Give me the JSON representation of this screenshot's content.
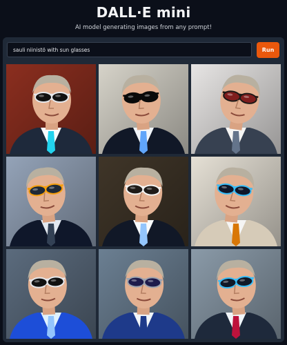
{
  "header": {
    "title": "DALL·E mini",
    "subtitle": "AI model generating images from any prompt!"
  },
  "prompt": {
    "value": "sauli niinistö with sun glasses"
  },
  "run_button": {
    "label": "Run"
  },
  "colors": {
    "background": "#0b0f19",
    "panel": "#1f2937",
    "accent": "#ea580c"
  },
  "images": [
    {
      "bg": "#8b2e1f",
      "suit": "#1e293b",
      "shirt": "#f8fafc",
      "tie": "#22d3ee",
      "lens": "#111111",
      "frame": "#e5e7eb"
    },
    {
      "bg": "#d6d3c9",
      "suit": "#111827",
      "shirt": "#f1f5f9",
      "tie": "#60a5fa",
      "lens": "#0a0a0a",
      "frame": "#0a0a0a"
    },
    {
      "bg": "#e7e5e4",
      "suit": "#374151",
      "shirt": "#f5f5f4",
      "tie": "#64748b",
      "lens": "#7f1d1d",
      "frame": "#1c1917"
    },
    {
      "bg": "#94a3b8",
      "suit": "#0f172a",
      "shirt": "#e2e8f0",
      "tie": "#334155",
      "lens": "#1f2937",
      "frame": "#f59e0b"
    },
    {
      "bg": "#3f3528",
      "suit": "#111827",
      "shirt": "#f8fafc",
      "tie": "#93c5fd",
      "lens": "#1f1b18",
      "frame": "#f5f5f4"
    },
    {
      "bg": "#e5e0d5",
      "suit": "#d6cbb8",
      "shirt": "#f5f5f4",
      "tie": "#d97706",
      "lens": "#0f172a",
      "frame": "#38bdf8"
    },
    {
      "bg": "#5b6b7d",
      "suit": "#1d4ed8",
      "shirt": "#e0f2fe",
      "tie": "#93c5fd",
      "lens": "#111111",
      "frame": "#e5e7eb"
    },
    {
      "bg": "#6b7f92",
      "suit": "#1e3a8a",
      "shirt": "#f1f5f9",
      "tie": "#1e3a8a",
      "lens": "#1e1b4b",
      "frame": "#9ca3af"
    },
    {
      "bg": "#8a9aa8",
      "suit": "#1e293b",
      "shirt": "#f1f5f9",
      "tie": "#be123c",
      "lens": "#111827",
      "frame": "#38bdf8"
    }
  ]
}
